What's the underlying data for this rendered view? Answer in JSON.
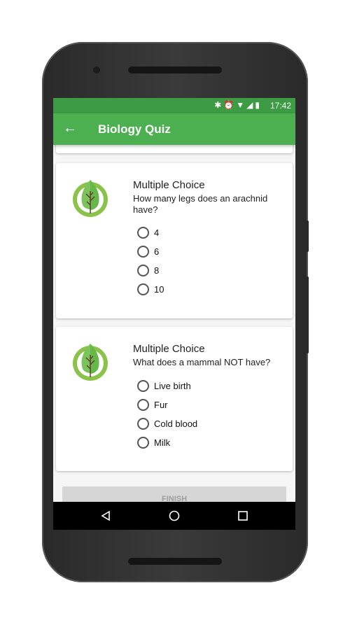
{
  "status_bar": {
    "time": "17:42",
    "icons": [
      "bluetooth-icon",
      "alarm-icon",
      "wifi-icon",
      "signal-icon",
      "battery-icon"
    ]
  },
  "app_bar": {
    "title": "Biology Quiz",
    "back_icon": "arrow-left-icon"
  },
  "questions": [
    {
      "type": "Multiple Choice",
      "text": "How many legs does an arachnid have?",
      "options": [
        "4",
        "6",
        "8",
        "10"
      ]
    },
    {
      "type": "Multiple Choice",
      "text": "What does a mammal NOT have?",
      "options": [
        "Live birth",
        "Fur",
        "Cold blood",
        "Milk"
      ]
    }
  ],
  "finish_label": "FINISH",
  "colors": {
    "primary": "#4caf50",
    "primary_dark": "#3d9b43"
  }
}
